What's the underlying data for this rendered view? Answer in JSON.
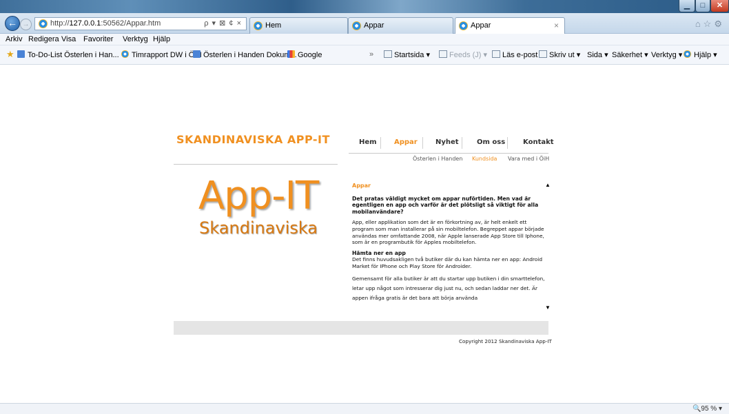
{
  "browser": {
    "address": {
      "prefix": "http://",
      "host": "127.0.0.1",
      "rest": ":50562/Appar.htm",
      "tools": "ρ ▾ ⊠ ¢ ×"
    },
    "tabs": [
      {
        "label": "Hem"
      },
      {
        "label": "Appar"
      },
      {
        "label": "Appar",
        "close": "×"
      }
    ],
    "menu": [
      "Arkiv",
      "Redigera",
      "Visa",
      "Favoriter",
      "Verktyg",
      "Hjälp"
    ],
    "favorites": [
      {
        "label": "To-Do-List Österlen i Han...",
        "icon": "doc-icon"
      },
      {
        "label": "Timrapport DW i ÖiH",
        "icon": "ie-icon"
      },
      {
        "label": "Österlen i Handen Dokum...",
        "icon": "doc-icon"
      },
      {
        "label": "Google",
        "icon": "google-icon"
      }
    ],
    "overflow": "»",
    "commands": {
      "start": "Startsida ▾",
      "feeds": "Feeds (J) ▾",
      "mail": "Läs e-post",
      "print": "Skriv ut ▾",
      "page": "Sida ▾",
      "safety": "Säkerhet ▾",
      "tools": "Verktyg ▾",
      "help": "Hjälp ▾"
    },
    "zoom": "🔍95 % ▾"
  },
  "site": {
    "title": "SKANDINAVISKA APP-IT",
    "nav": [
      {
        "label": "Hem"
      },
      {
        "label": "Appar",
        "active": true
      },
      {
        "label": "Nyhet"
      },
      {
        "label": "Om oss"
      },
      {
        "label": "Kontakt"
      }
    ],
    "subnav": [
      {
        "label": "Österlen i Handen"
      },
      {
        "label": "Kundsida",
        "active": true
      },
      {
        "label": "Vara med i ÖiH"
      }
    ],
    "brand": {
      "big": "App-IT",
      "small": "Skandinaviska"
    },
    "content": {
      "heading": "Appar",
      "lead": "Det pratas väldigt mycket om appar nuförtiden. Men vad är egentligen en app och varför är det plötsligt så viktigt för alla mobilanvändare?",
      "p1": "App, eller applikation som det är en förkortning av, är helt enkelt ett program som man installerar på sin mobiltelefon. Begreppet appar började användas mer omfattande 2008, när Apple lanserade App Store till Iphone, som är en programbutik för Apples mobiltelefon.",
      "h3": "Hämta ner en app",
      "p2": "Det finns huvudsakligen två butiker där du kan hämta ner en app: Android Market för IPhone och Play Store för Androider.",
      "p3": "Gemensamt för alla butiker är att du startar upp butiken i din smarttelefon, letar upp något som intresserar dig just nu, och sedan laddar ner det. Är appen ifråga gratis är det bara att börja använda"
    },
    "copyright": "Copyright 2012 Skandinaviska App-IT"
  },
  "colors": {
    "accent": "#f09020",
    "footer": "#e5e5e5"
  }
}
